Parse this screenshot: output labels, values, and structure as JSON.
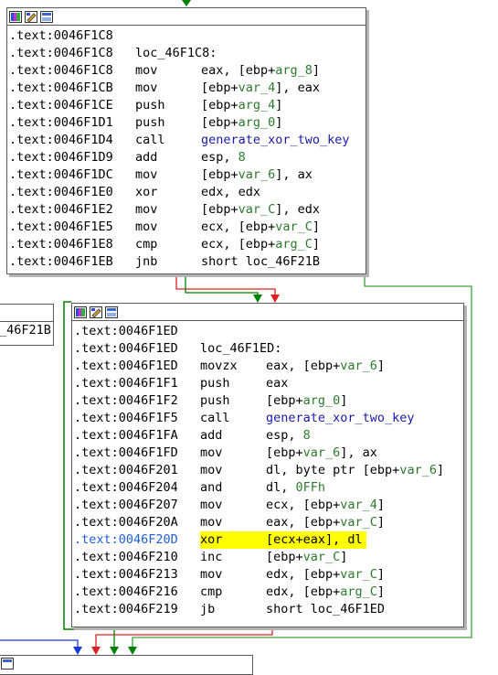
{
  "colors": {
    "true_edge": "#008000",
    "false_edge": "#e02020",
    "next_edge": "#1a3ad6",
    "highlight": "#ffff00"
  },
  "toolbar_icons": [
    "graph-colors-icon",
    "edit-node-icon",
    "zoom-graph-icon"
  ],
  "block1": {
    "lines": [
      {
        "addr": ".text:0046F1C8",
        "label": "",
        "mnem": "",
        "ops": ""
      },
      {
        "addr": ".text:0046F1C8",
        "label": "loc_46F1C8:",
        "mnem": "",
        "ops": ""
      },
      {
        "addr": ".text:0046F1C8",
        "label": "",
        "mnem": "mov",
        "ops": "eax, [ebp+arg_8]"
      },
      {
        "addr": ".text:0046F1CB",
        "label": "",
        "mnem": "mov",
        "ops": "[ebp+var_4], eax"
      },
      {
        "addr": ".text:0046F1CE",
        "label": "",
        "mnem": "push",
        "ops": "[ebp+arg_4]"
      },
      {
        "addr": ".text:0046F1D1",
        "label": "",
        "mnem": "push",
        "ops": "[ebp+arg_0]"
      },
      {
        "addr": ".text:0046F1D4",
        "label": "",
        "mnem": "call",
        "ops": "generate_xor_two_key"
      },
      {
        "addr": ".text:0046F1D9",
        "label": "",
        "mnem": "add",
        "ops": "esp, 8"
      },
      {
        "addr": ".text:0046F1DC",
        "label": "",
        "mnem": "mov",
        "ops": "[ebp+var_6], ax"
      },
      {
        "addr": ".text:0046F1E0",
        "label": "",
        "mnem": "xor",
        "ops": "edx, edx"
      },
      {
        "addr": ".text:0046F1E2",
        "label": "",
        "mnem": "mov",
        "ops": "[ebp+var_C], edx"
      },
      {
        "addr": ".text:0046F1E5",
        "label": "",
        "mnem": "mov",
        "ops": "ecx, [ebp+var_C]"
      },
      {
        "addr": ".text:0046F1E8",
        "label": "",
        "mnem": "cmp",
        "ops": "ecx, [ebp+arg_C]"
      },
      {
        "addr": ".text:0046F1EB",
        "label": "",
        "mnem": "jnb",
        "ops": "short loc_46F21B"
      }
    ]
  },
  "block2": {
    "lines": [
      {
        "addr": ".text:0046F1ED",
        "label": "",
        "mnem": "",
        "ops": ""
      },
      {
        "addr": ".text:0046F1ED",
        "label": "loc_46F1ED:",
        "mnem": "",
        "ops": ""
      },
      {
        "addr": ".text:0046F1ED",
        "label": "",
        "mnem": "movzx",
        "ops": "eax, [ebp+var_6]"
      },
      {
        "addr": ".text:0046F1F1",
        "label": "",
        "mnem": "push",
        "ops": "eax"
      },
      {
        "addr": ".text:0046F1F2",
        "label": "",
        "mnem": "push",
        "ops": "[ebp+arg_0]"
      },
      {
        "addr": ".text:0046F1F5",
        "label": "",
        "mnem": "call",
        "ops": "generate_xor_two_key"
      },
      {
        "addr": ".text:0046F1FA",
        "label": "",
        "mnem": "add",
        "ops": "esp, 8"
      },
      {
        "addr": ".text:0046F1FD",
        "label": "",
        "mnem": "mov",
        "ops": "[ebp+var_6], ax"
      },
      {
        "addr": ".text:0046F201",
        "label": "",
        "mnem": "mov",
        "ops": "dl, byte ptr [ebp+var_6]"
      },
      {
        "addr": ".text:0046F204",
        "label": "",
        "mnem": "and",
        "ops": "dl, 0FFh"
      },
      {
        "addr": ".text:0046F207",
        "label": "",
        "mnem": "mov",
        "ops": "ecx, [ebp+var_4]"
      },
      {
        "addr": ".text:0046F20A",
        "label": "",
        "mnem": "mov",
        "ops": "eax, [ebp+var_C]"
      },
      {
        "addr": ".text:0046F20D",
        "label": "",
        "mnem": "xor",
        "ops": "[ecx+eax], dl",
        "current": true
      },
      {
        "addr": ".text:0046F210",
        "label": "",
        "mnem": "inc",
        "ops": "[ebp+var_C]"
      },
      {
        "addr": ".text:0046F213",
        "label": "",
        "mnem": "mov",
        "ops": "edx, [ebp+var_C]"
      },
      {
        "addr": ".text:0046F216",
        "label": "",
        "mnem": "cmp",
        "ops": "edx, [ebp+arg_C]"
      },
      {
        "addr": ".text:0046F219",
        "label": "",
        "mnem": "jb",
        "ops": "short loc_46F1ED"
      }
    ]
  },
  "side_stub": {
    "text": "_46F21B"
  }
}
